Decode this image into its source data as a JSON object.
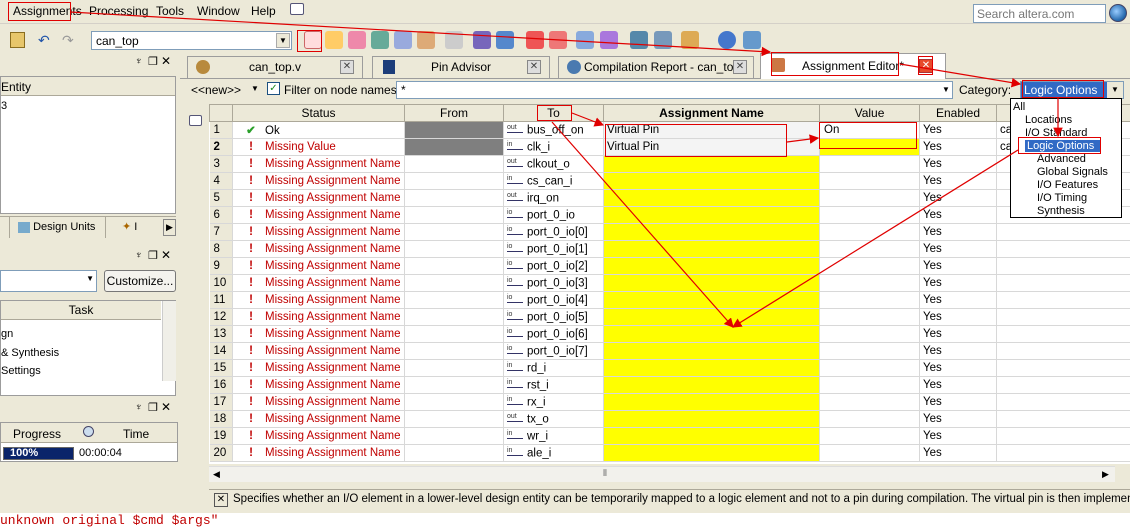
{
  "menu": {
    "items": [
      "Assignments",
      "Processing",
      "Tools",
      "Window",
      "Help"
    ]
  },
  "search": {
    "placeholder": "Search altera.com"
  },
  "toolbar": {
    "entity": "can_top"
  },
  "tabs": [
    {
      "label": "can_top.v",
      "close": "✕"
    },
    {
      "label": "Pin Advisor",
      "close": "✕"
    },
    {
      "label": "Compilation Report - can_top",
      "close": "✕"
    },
    {
      "label": "Assignment Editor*",
      "close": "✕"
    }
  ],
  "left": {
    "entity_header": "Entity",
    "entity_item": "3",
    "design_units_tab": "Design Units",
    "other_tab": "I",
    "customize_button": "Customize...",
    "task_header": "Task",
    "tasks": [
      "gn",
      "& Synthesis",
      "Settings"
    ],
    "progress_header": "Progress",
    "time_header": "Time",
    "progress_value": "100%",
    "progress_fraction": 1.0,
    "time_value": "00:00:04"
  },
  "filter": {
    "new_label": "<<new>>",
    "checkbox_label": "Filter on node names:",
    "value": "*",
    "category_label": "Category:",
    "category_value": "Logic Options"
  },
  "categories": [
    {
      "label": "All",
      "indent": 0,
      "selected": false
    },
    {
      "label": "Locations",
      "indent": 1,
      "selected": false
    },
    {
      "label": "I/O Standard",
      "indent": 1,
      "selected": false
    },
    {
      "label": "Logic Options",
      "indent": 1,
      "selected": true
    },
    {
      "label": "Advanced",
      "indent": 2,
      "selected": false
    },
    {
      "label": "Global Signals",
      "indent": 2,
      "selected": false
    },
    {
      "label": "I/O Features",
      "indent": 2,
      "selected": false
    },
    {
      "label": "I/O Timing",
      "indent": 2,
      "selected": false
    },
    {
      "label": "Synthesis",
      "indent": 2,
      "selected": false
    }
  ],
  "grid": {
    "headers": {
      "status": "Status",
      "from": "From",
      "to": "To",
      "name": "Assignment Name",
      "value": "Value",
      "enabled": "Enabled"
    },
    "rows": [
      {
        "n": "1",
        "status": "Ok",
        "ok": true,
        "dir": "out",
        "to": "bus_off_on",
        "name": "Virtual Pin",
        "value": "On",
        "enabled": "Yes",
        "extra": "ca"
      },
      {
        "n": "2",
        "status": "Missing Value",
        "ok": false,
        "dir": "in",
        "to": "clk_i",
        "name": "Virtual Pin",
        "value": "",
        "enabled": "Yes",
        "extra": "ca"
      },
      {
        "n": "3",
        "status": "Missing Assignment Name",
        "ok": false,
        "dir": "out",
        "to": "clkout_o",
        "name": "",
        "value": "",
        "enabled": "Yes",
        "extra": ""
      },
      {
        "n": "4",
        "status": "Missing Assignment Name",
        "ok": false,
        "dir": "in",
        "to": "cs_can_i",
        "name": "",
        "value": "",
        "enabled": "Yes",
        "extra": ""
      },
      {
        "n": "5",
        "status": "Missing Assignment Name",
        "ok": false,
        "dir": "out",
        "to": "irq_on",
        "name": "",
        "value": "",
        "enabled": "Yes",
        "extra": ""
      },
      {
        "n": "6",
        "status": "Missing Assignment Name",
        "ok": false,
        "dir": "io",
        "to": "port_0_io",
        "name": "",
        "value": "",
        "enabled": "Yes",
        "extra": ""
      },
      {
        "n": "7",
        "status": "Missing Assignment Name",
        "ok": false,
        "dir": "io",
        "to": "port_0_io[0]",
        "name": "",
        "value": "",
        "enabled": "Yes",
        "extra": ""
      },
      {
        "n": "8",
        "status": "Missing Assignment Name",
        "ok": false,
        "dir": "io",
        "to": "port_0_io[1]",
        "name": "",
        "value": "",
        "enabled": "Yes",
        "extra": ""
      },
      {
        "n": "9",
        "status": "Missing Assignment Name",
        "ok": false,
        "dir": "io",
        "to": "port_0_io[2]",
        "name": "",
        "value": "",
        "enabled": "Yes",
        "extra": ""
      },
      {
        "n": "10",
        "status": "Missing Assignment Name",
        "ok": false,
        "dir": "io",
        "to": "port_0_io[3]",
        "name": "",
        "value": "",
        "enabled": "Yes",
        "extra": ""
      },
      {
        "n": "11",
        "status": "Missing Assignment Name",
        "ok": false,
        "dir": "io",
        "to": "port_0_io[4]",
        "name": "",
        "value": "",
        "enabled": "Yes",
        "extra": ""
      },
      {
        "n": "12",
        "status": "Missing Assignment Name",
        "ok": false,
        "dir": "io",
        "to": "port_0_io[5]",
        "name": "",
        "value": "",
        "enabled": "Yes",
        "extra": ""
      },
      {
        "n": "13",
        "status": "Missing Assignment Name",
        "ok": false,
        "dir": "io",
        "to": "port_0_io[6]",
        "name": "",
        "value": "",
        "enabled": "Yes",
        "extra": ""
      },
      {
        "n": "14",
        "status": "Missing Assignment Name",
        "ok": false,
        "dir": "io",
        "to": "port_0_io[7]",
        "name": "",
        "value": "",
        "enabled": "Yes",
        "extra": ""
      },
      {
        "n": "15",
        "status": "Missing Assignment Name",
        "ok": false,
        "dir": "in",
        "to": "rd_i",
        "name": "",
        "value": "",
        "enabled": "Yes",
        "extra": ""
      },
      {
        "n": "16",
        "status": "Missing Assignment Name",
        "ok": false,
        "dir": "in",
        "to": "rst_i",
        "name": "",
        "value": "",
        "enabled": "Yes",
        "extra": ""
      },
      {
        "n": "17",
        "status": "Missing Assignment Name",
        "ok": false,
        "dir": "in",
        "to": "rx_i",
        "name": "",
        "value": "",
        "enabled": "Yes",
        "extra": ""
      },
      {
        "n": "18",
        "status": "Missing Assignment Name",
        "ok": false,
        "dir": "out",
        "to": "tx_o",
        "name": "",
        "value": "",
        "enabled": "Yes",
        "extra": ""
      },
      {
        "n": "19",
        "status": "Missing Assignment Name",
        "ok": false,
        "dir": "in",
        "to": "wr_i",
        "name": "",
        "value": "",
        "enabled": "Yes",
        "extra": ""
      },
      {
        "n": "20",
        "status": "Missing Assignment Name",
        "ok": false,
        "dir": "in",
        "to": "ale_i",
        "name": "",
        "value": "",
        "enabled": "Yes",
        "extra": ""
      }
    ]
  },
  "description": "Specifies whether an I/O element in a lower-level design entity can be temporarily mapped to a logic element and not to a pin during compilation. The virtual pin is then implemented as a",
  "tcl_line": "unknown original $cmd $args\"",
  "colors": {
    "annotation": "#e00000",
    "missing": "#c00000",
    "highlight": "#ffff00",
    "selection": "#316ac5"
  }
}
